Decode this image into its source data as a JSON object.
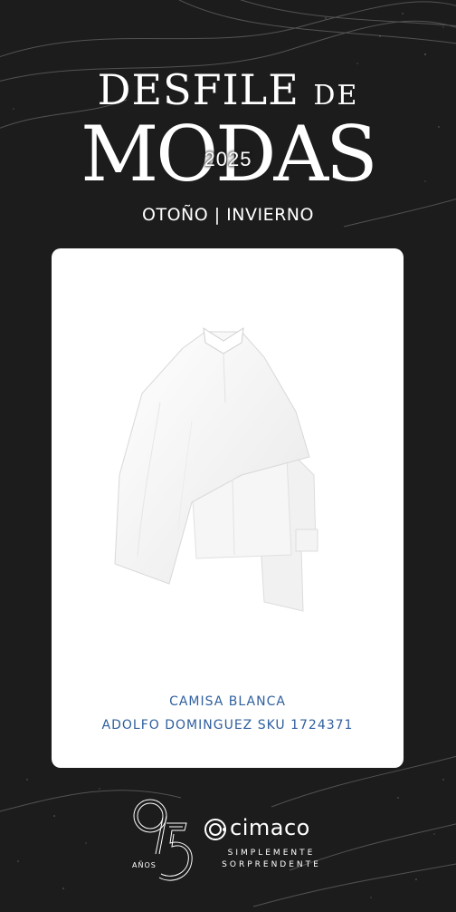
{
  "header": {
    "title_main": "DESFILE",
    "title_de": "DE",
    "title_big": "MODAS",
    "year": "2025",
    "season": "OTOÑO | INVIERNO"
  },
  "product": {
    "name": "CAMISA BLANCA",
    "brand_sku": "ADOLFO DOMINGUEZ SKU 1724371",
    "text_color": "#2f5f9e"
  },
  "footer": {
    "anniversary_number": "95",
    "anniversary_label": "AÑOS",
    "brand": "cimaco",
    "tagline_line1": "SIMPLEMENTE",
    "tagline_line2": "SORPRENDENTE"
  },
  "colors": {
    "background": "#1c1c1c",
    "card": "#ffffff",
    "text_light": "#ffffff"
  },
  "icons": {
    "product": "white-cape-shirt-image",
    "brand": "cimaco-logo-icon"
  }
}
